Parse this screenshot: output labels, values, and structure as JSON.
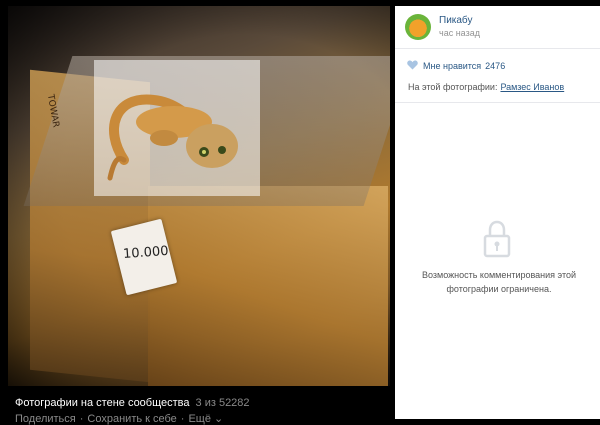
{
  "photo_footer": {
    "album": "Фотографии на стене сообщества",
    "counter": "3 из 52282",
    "share": "Поделиться",
    "save": "Сохранить к себе",
    "more": "Ещё"
  },
  "photo": {
    "price_tag": "10.000",
    "brand_text": "TOWAR"
  },
  "sidebar": {
    "community_name": "Пикабу",
    "post_time": "час назад",
    "likes_label": "Мне нравится",
    "likes_count": "2476",
    "tagged_label": "На этой фотографии:",
    "tagged_person": "Рамзес Иванов",
    "comments_restricted": "Возможность комментирования этой фотографии ограничена."
  },
  "colors": {
    "link": "#2a5885",
    "muted": "#939393",
    "heart": "#a8c4e2"
  },
  "icons": [
    "heart-icon",
    "lock-icon",
    "chevron-down-icon"
  ]
}
